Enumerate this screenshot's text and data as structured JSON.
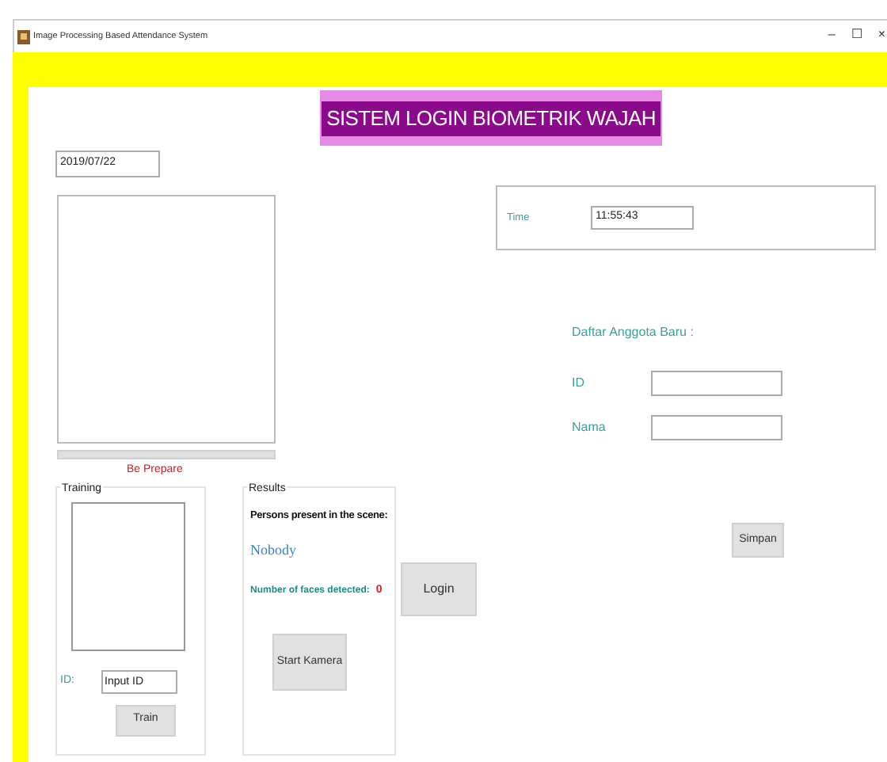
{
  "window": {
    "title": "Image Processing Based  Attendance System",
    "controls": [
      "–",
      "☐",
      "×"
    ]
  },
  "banner": "SISTEM LOGIN BIOMETRIK WAJAH",
  "date": "2019/07/22",
  "camera": {
    "progress": {
      "level": 0
    },
    "status": "Be Prepare"
  },
  "training": {
    "title": "Training",
    "id_label": "ID:",
    "id_value": "Input ID",
    "button": "Train"
  },
  "results": {
    "title": "Results",
    "persons_label": "Persons present in the scene:",
    "persons_value": "Nobody",
    "faces_label": "Number of faces detected:",
    "faces_count": "0",
    "button": "Start Kamera"
  },
  "login_button": "Login",
  "time": {
    "label": "Time",
    "value": "11:55:43"
  },
  "register": {
    "heading": "Daftar Anggota Baru :",
    "fields": [
      {
        "label": "ID"
      },
      {
        "label": "Nama"
      }
    ],
    "button": "Simpan"
  }
}
